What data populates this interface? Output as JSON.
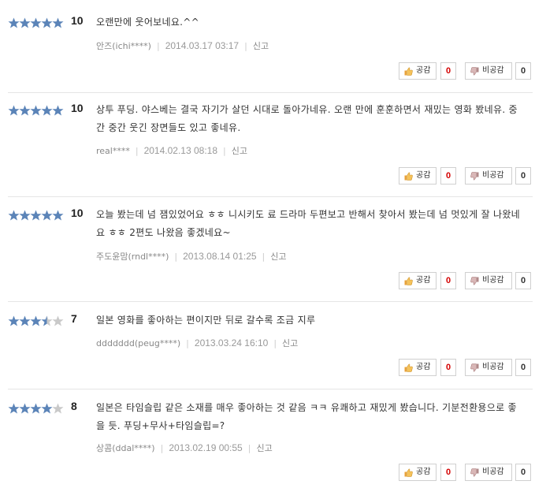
{
  "labels": {
    "like": "공감",
    "dislike": "비공감",
    "report": "신고"
  },
  "colors": {
    "star_on": "#5b84b8",
    "star_off": "#c9c9c9",
    "like_count": "#d40000"
  },
  "reviews": [
    {
      "rating": 5,
      "score": "10",
      "text": "오랜만에 웃어보네요.^^",
      "user": "안즈(ichi****)",
      "date": "2014.03.17 03:17",
      "likes": "0",
      "dislikes": "0"
    },
    {
      "rating": 5,
      "score": "10",
      "text": "상투 푸딩. 야스베는 결국 자기가 살던 시대로 돌아가네유. 오랜 만에 훈훈하면서 재밌는 영화 봤네유. 중간 중간 웃긴 장면들도 있고 좋네유.",
      "user": "real****",
      "date": "2014.02.13 08:18",
      "likes": "0",
      "dislikes": "0"
    },
    {
      "rating": 5,
      "score": "10",
      "text": "오늘 봤는데 넘 잼있었어요 ㅎㅎ 니시키도 료 드라마 두편보고 반해서 찾아서 봤는데 넘 멋있게 잘 나왔네요 ㅎㅎ 2편도 나왔음 좋겠네요~",
      "user": "주도윤맘(rndl****)",
      "date": "2013.08.14 01:25",
      "likes": "0",
      "dislikes": "0"
    },
    {
      "rating": 3.5,
      "score": "7",
      "text": "일본 영화를 좋아하는 편이지만 뒤로 갈수록 조금 지루",
      "user": "ddddddd(peug****)",
      "date": "2013.03.24 16:10",
      "likes": "0",
      "dislikes": "0"
    },
    {
      "rating": 4,
      "score": "8",
      "text": "일본은 타임슬립 같은 소재를 매우 좋아하는 것 같음 ㅋㅋ 유쾌하고 재밌게 봤습니다. 기분전환용으로 좋을 듯. 푸딩+무사+타임슬립=?",
      "user": "상콤(ddal****)",
      "date": "2013.02.19 00:55",
      "likes": "0",
      "dislikes": "0"
    }
  ]
}
